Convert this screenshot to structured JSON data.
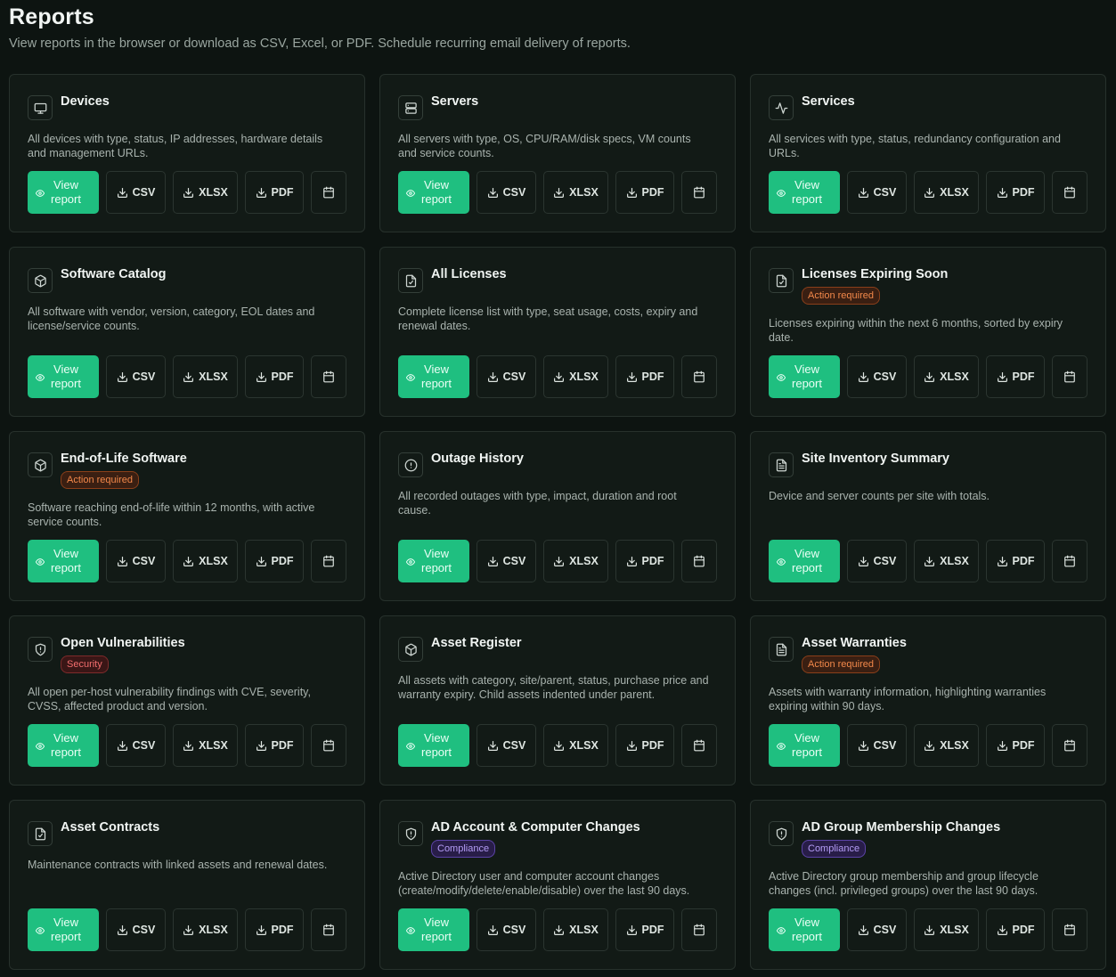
{
  "page": {
    "title": "Reports",
    "subtitle": "View reports in the browser or download as CSV, Excel, or PDF. Schedule recurring email delivery of reports."
  },
  "actions": {
    "view": "View report",
    "csv": "CSV",
    "xlsx": "XLSX",
    "pdf": "PDF"
  },
  "colors": {
    "background": "#0d1411",
    "card": "#121a16",
    "accent": "#1fbf80",
    "badge_action": "#f2884a",
    "badge_security": "#f16d6d",
    "badge_compliance": "#b49cf5"
  },
  "reports": [
    {
      "id": "devices",
      "icon": "monitor-icon",
      "title": "Devices",
      "badge": null,
      "description": "All devices with type, status, IP addresses, hardware details and management URLs."
    },
    {
      "id": "servers",
      "icon": "server-icon",
      "title": "Servers",
      "badge": null,
      "description": "All servers with type, OS, CPU/RAM/disk specs, VM counts and service counts."
    },
    {
      "id": "services",
      "icon": "activity-icon",
      "title": "Services",
      "badge": null,
      "description": "All services with type, status, redundancy configuration and URLs."
    },
    {
      "id": "software-catalog",
      "icon": "package-icon",
      "title": "Software Catalog",
      "badge": null,
      "description": "All software with vendor, version, category, EOL dates and license/service counts."
    },
    {
      "id": "all-licenses",
      "icon": "file-check-icon",
      "title": "All Licenses",
      "badge": null,
      "description": "Complete license list with type, seat usage, costs, expiry and renewal dates."
    },
    {
      "id": "licenses-expiring",
      "icon": "file-check-icon",
      "title": "Licenses Expiring Soon",
      "badge": {
        "type": "action",
        "label": "Action required"
      },
      "description": "Licenses expiring within the next 6 months, sorted by expiry date."
    },
    {
      "id": "eol-software",
      "icon": "package-icon",
      "title": "End-of-Life Software",
      "badge": {
        "type": "action",
        "label": "Action required"
      },
      "description": "Software reaching end-of-life within 12 months, with active service counts."
    },
    {
      "id": "outage-history",
      "icon": "alert-circle-icon",
      "title": "Outage History",
      "badge": null,
      "description": "All recorded outages with type, impact, duration and root cause."
    },
    {
      "id": "site-inventory",
      "icon": "file-text-icon",
      "title": "Site Inventory Summary",
      "badge": null,
      "description": "Device and server counts per site with totals."
    },
    {
      "id": "open-vulns",
      "icon": "shield-icon",
      "title": "Open Vulnerabilities",
      "badge": {
        "type": "security",
        "label": "Security"
      },
      "description": "All open per-host vulnerability findings with CVE, severity, CVSS, affected product and version."
    },
    {
      "id": "asset-register",
      "icon": "package-icon",
      "title": "Asset Register",
      "badge": null,
      "description": "All assets with category, site/parent, status, purchase price and warranty expiry. Child assets indented under parent."
    },
    {
      "id": "asset-warranties",
      "icon": "file-text-icon",
      "title": "Asset Warranties",
      "badge": {
        "type": "action",
        "label": "Action required"
      },
      "description": "Assets with warranty information, highlighting warranties expiring within 90 days."
    },
    {
      "id": "asset-contracts",
      "icon": "file-check-icon",
      "title": "Asset Contracts",
      "badge": null,
      "description": "Maintenance contracts with linked assets and renewal dates."
    },
    {
      "id": "ad-account-changes",
      "icon": "shield-icon",
      "title": "AD Account & Computer Changes",
      "badge": {
        "type": "compliance",
        "label": "Compliance"
      },
      "description": "Active Directory user and computer account changes (create/modify/delete/enable/disable) over the last 90 days."
    },
    {
      "id": "ad-group-changes",
      "icon": "shield-icon",
      "title": "AD Group Membership Changes",
      "badge": {
        "type": "compliance",
        "label": "Compliance"
      },
      "description": "Active Directory group membership and group lifecycle changes (incl. privileged groups) over the last 90 days."
    }
  ]
}
